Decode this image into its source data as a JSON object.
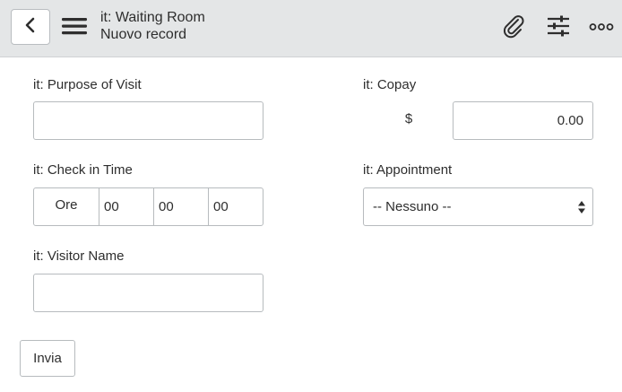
{
  "header": {
    "title": "it: Waiting Room",
    "subtitle": "Nuovo record",
    "icons": [
      "back-icon",
      "hamburger-menu-icon",
      "paperclip-icon",
      "sliders-icon",
      "more-options-icon"
    ]
  },
  "form": {
    "purpose": {
      "label": "it: Purpose of Visit",
      "value": ""
    },
    "copay": {
      "label": "it: Copay",
      "currency": "$",
      "value": "0.00"
    },
    "check_in": {
      "label": "it: Check in Time",
      "prefix": "Ore",
      "hours": "00",
      "minutes": "00",
      "seconds": "00"
    },
    "appointment": {
      "label": "it: Appointment",
      "selected": "-- Nessuno --"
    },
    "visitor": {
      "label": "it: Visitor Name",
      "value": ""
    },
    "submit_label": "Invia"
  },
  "colors": {
    "header_bg": "#e4e6e7",
    "border": "#b7bbbe",
    "text": "#2e2e2e"
  }
}
